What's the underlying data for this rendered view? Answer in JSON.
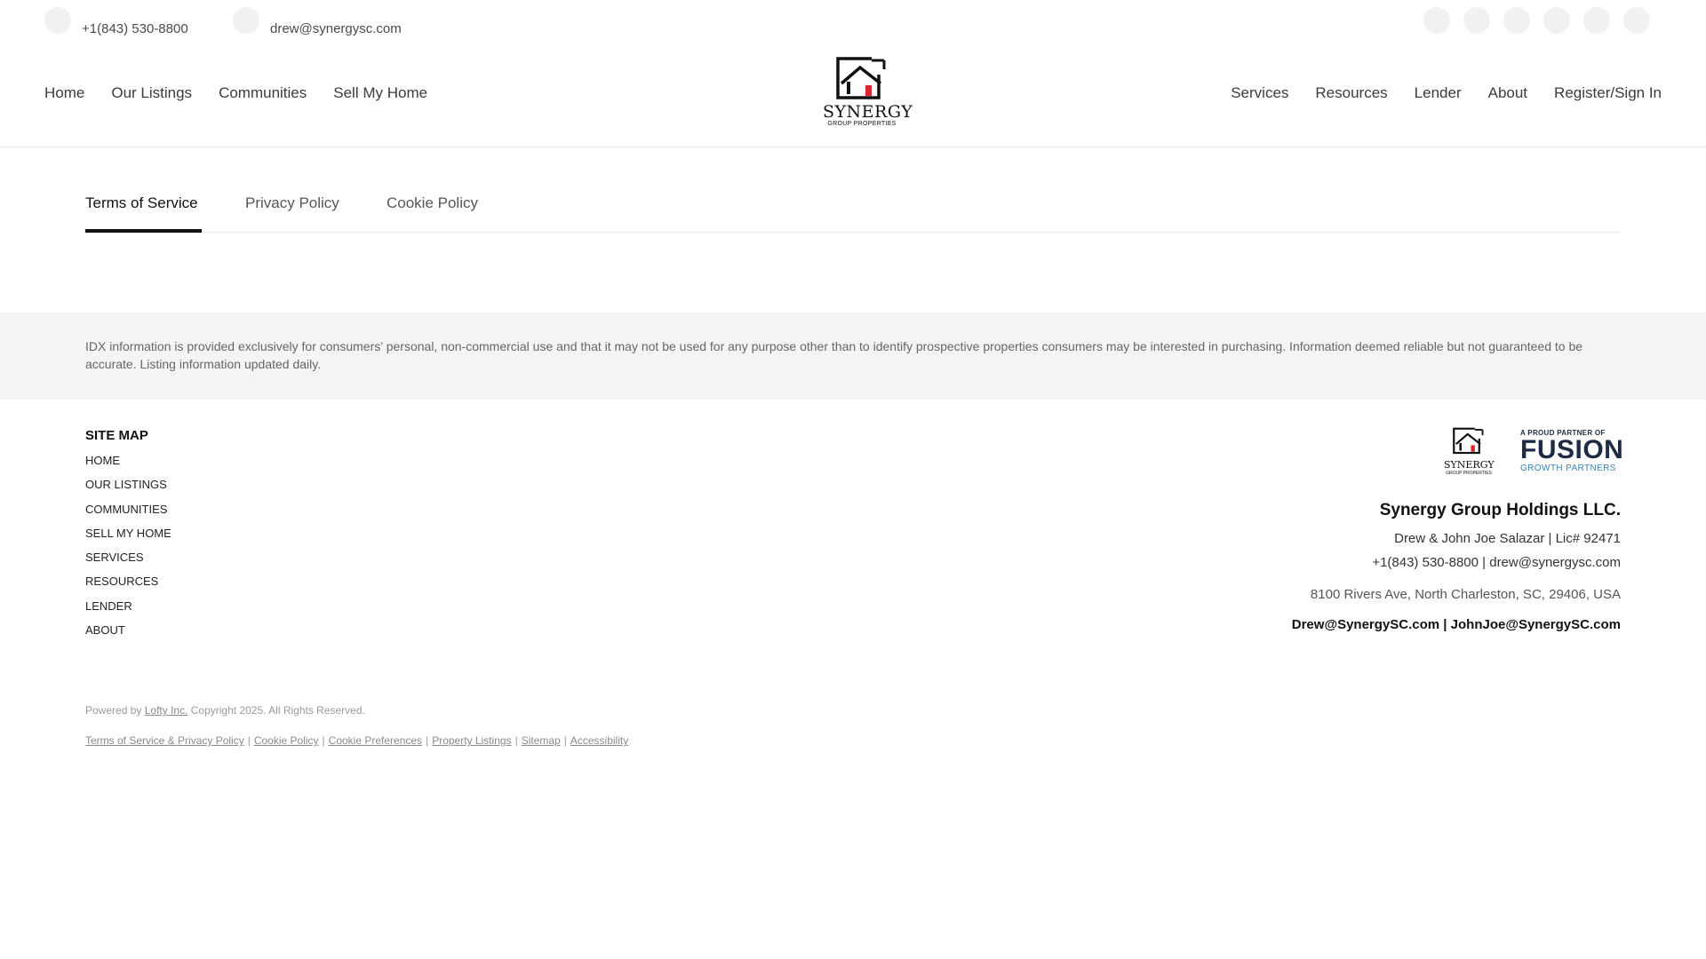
{
  "topbar": {
    "phone": "+1(843) 530-8800",
    "email": "drew@synergysc.com",
    "social_icons": [
      "social-icon-1",
      "social-icon-2",
      "social-icon-3",
      "social-icon-4",
      "social-icon-5",
      "social-icon-6"
    ]
  },
  "nav": {
    "left": [
      "Home",
      "Our Listings",
      "Communities",
      "Sell My Home"
    ],
    "right": [
      "Services",
      "Resources",
      "Lender",
      "About"
    ],
    "register": "Register/Sign In",
    "logo_word": "SYNERGY",
    "logo_sub": "GROUP PROPERTIES"
  },
  "tabs": [
    {
      "label": "Terms of Service",
      "active": true
    },
    {
      "label": "Privacy Policy",
      "active": false
    },
    {
      "label": "Cookie Policy",
      "active": false
    }
  ],
  "idx_disclaimer": "IDX information is provided exclusively for consumers’ personal, non-commercial use and that it may not be used for any purpose other than to identify prospective properties consumers may be interested in purchasing. Information deemed reliable but not guaranteed to be accurate. Listing information updated daily.",
  "sitemap": {
    "title": "SITE MAP",
    "items": [
      "HOME",
      "OUR LISTINGS",
      "COMMUNITIES",
      "SELL MY HOME",
      "SERVICES",
      "RESOURCES",
      "LENDER",
      "ABOUT"
    ]
  },
  "footer": {
    "mini_logo_word": "SYNERGY",
    "mini_logo_sub": "GROUP PROPERTIES",
    "fusion_proud": "A PROUD PARTNER OF",
    "fusion_big": "FUSION",
    "fusion_growth": "GROWTH PARTNERS",
    "company": "Synergy Group Holdings LLC.",
    "agents": "Drew & John Joe Salazar  |  Lic# 92471",
    "phone_email": "+1(843) 530-8800  |  drew@synergysc.com",
    "address": "8100 Rivers Ave, North Charleston, SC, 29406, USA",
    "emails": "Drew@SynergySC.com | JohnJoe@SynergySC.com"
  },
  "powered": {
    "prefix": "Powered by",
    "link": "Lofty Inc.",
    "suffix": " Copyright 2025. All Rights Reserved."
  },
  "legal_links": [
    "Terms of Service & Privacy Policy",
    "Cookie Policy",
    "Cookie Preferences",
    "Property Listings",
    "Sitemap",
    "Accessibility"
  ],
  "colors": {
    "accent_red": "#d8262c",
    "fusion_navy": "#1d2b44",
    "fusion_blue": "#3a84b5"
  }
}
